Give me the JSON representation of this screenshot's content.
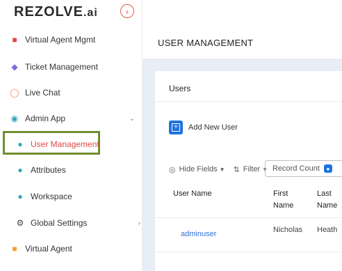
{
  "brand": {
    "logo_main": "REZOLVE",
    "logo_suffix": ".ai"
  },
  "sidebar": {
    "collapse_icon": "chevron-left-circle-icon",
    "items": [
      {
        "label": "Virtual Agent Mgmt",
        "icon": "puzzle-icon",
        "icon_color": "#e04848"
      },
      {
        "label": "Ticket Management",
        "icon": "ticket-icon",
        "icon_color": "#7b6fd6"
      },
      {
        "label": "Live Chat",
        "icon": "chat-bubbles-icon",
        "icon_color": "#f08a5d"
      },
      {
        "label": "Admin App",
        "icon": "user-circle-icon",
        "icon_color": "#2aa6b8",
        "expanded": true
      },
      {
        "label": "User Management",
        "icon": "users-icon",
        "icon_color": "#2aa6b8",
        "active": true
      },
      {
        "label": "Attributes",
        "icon": "users-icon",
        "icon_color": "#2aa6b8"
      },
      {
        "label": "Workspace",
        "icon": "users-icon",
        "icon_color": "#2aa6b8"
      },
      {
        "label": "Global Settings",
        "icon": "gears-icon",
        "icon_color": "#444444"
      },
      {
        "label": "Virtual Agent",
        "icon": "info-square-icon",
        "icon_color": "#f0a030"
      }
    ]
  },
  "header": {
    "title": "USER MANAGEMENT"
  },
  "card": {
    "title": "Users",
    "add_button": "Add New User",
    "toolbar": {
      "hide_fields": "Hide Fields",
      "filter": "Filter",
      "record_count_placeholder": "Record Count"
    },
    "table": {
      "columns": [
        {
          "line1": "User Name",
          "line2": ""
        },
        {
          "line1": "First",
          "line2": "Name"
        },
        {
          "line1": "Last",
          "line2": "Name"
        }
      ],
      "rows": [
        {
          "user_name": "adminuser",
          "first_name": "Nicholas",
          "last_name": "Heath"
        }
      ]
    }
  },
  "colors": {
    "accent": "#1f73e0",
    "active_text": "#e04848",
    "highlight_border": "#6f8f2f",
    "content_bg": "#e8eef6"
  }
}
